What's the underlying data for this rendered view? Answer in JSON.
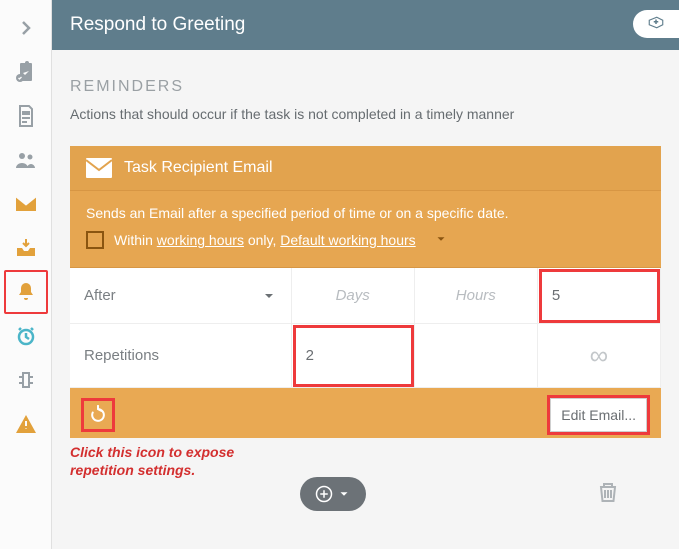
{
  "header": {
    "title": "Respond to Greeting"
  },
  "section": {
    "title": "REMINDERS",
    "subtitle": "Actions that should occur if the task is not completed in a timely manner"
  },
  "card": {
    "title": "Task Recipient Email",
    "description": "Sends an Email after a specified period of time or on a specific date.",
    "within_prefix": "Within ",
    "working_hours": "working hours",
    "only_text": " only, ",
    "default_working_hours": "Default working hours",
    "rows": {
      "after_label": "After",
      "days_placeholder": "Days",
      "hours_placeholder": "Hours",
      "minutes_value": "5",
      "repetitions_label": "Repetitions",
      "repetitions_value": "2",
      "infinity": "∞"
    },
    "edit_label": "Edit Email..."
  },
  "hint": {
    "line1": "Click this icon to expose",
    "line2": "repetition settings."
  }
}
